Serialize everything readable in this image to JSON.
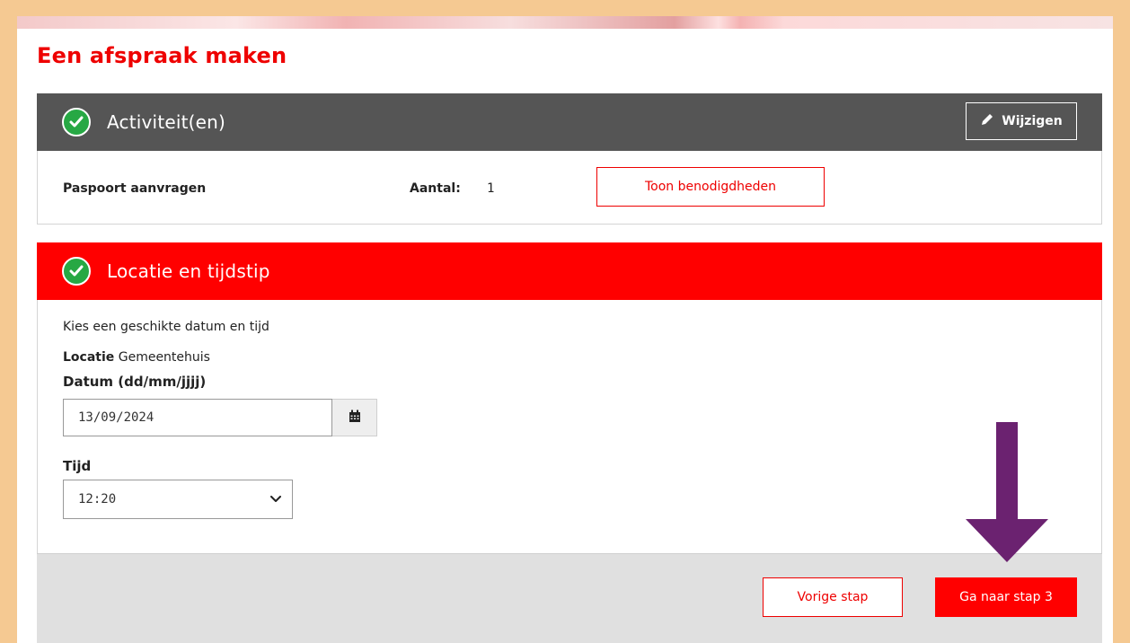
{
  "page": {
    "title": "Een afspraak maken"
  },
  "panels": {
    "activity": {
      "title": "Activiteit(en)",
      "edit_label": "Wijzigen",
      "item_name": "Paspoort aanvragen",
      "count_label": "Aantal:",
      "count_value": "1",
      "requirements_button": "Toon benodigdheden"
    },
    "location": {
      "title": "Locatie en tijdstip",
      "instruction": "Kies een geschikte datum en tijd",
      "location_label": "Locatie",
      "location_value": "Gemeentehuis",
      "date_label": "Datum (dd/mm/jjjj)",
      "date_value": "13/09/2024",
      "time_label": "Tijd",
      "time_value": "12:20"
    }
  },
  "footer": {
    "prev_button": "Vorige stap",
    "next_button": "Ga naar stap 3"
  },
  "colors": {
    "brand_red": "#ff0000",
    "header_gray": "#555555",
    "check_green": "#27a844",
    "annotation_arrow": "#6b2270",
    "page_border": "#f5c992"
  },
  "icons": {
    "check": "check-circle-icon",
    "edit": "pencil-icon",
    "calendar": "calendar-icon",
    "dropdown": "chevron-down-icon",
    "annotation": "arrow-down-icon"
  }
}
